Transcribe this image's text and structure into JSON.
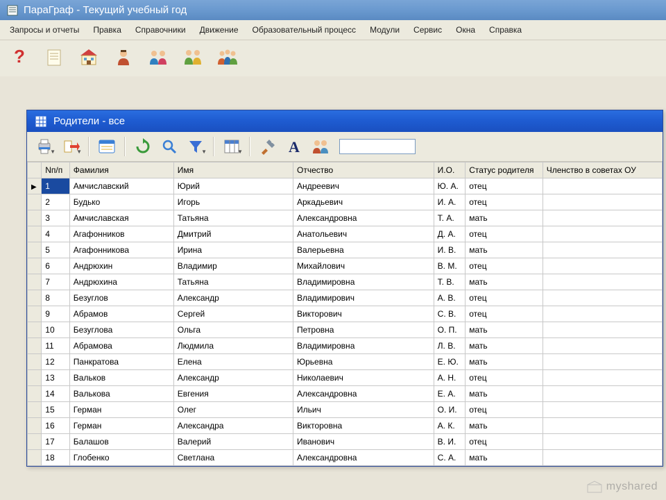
{
  "app": {
    "title": "ПараГраф - Текущий учебный год"
  },
  "menu": {
    "items": [
      "Запросы и отчеты",
      "Правка",
      "Справочники",
      "Движение",
      "Образовательный процесс",
      "Модули",
      "Сервис",
      "Окна",
      "Справка"
    ]
  },
  "child": {
    "title": "Родители - все",
    "search_value": ""
  },
  "table": {
    "headers": {
      "num": "Nп/п",
      "fam": "Фамилия",
      "name": "Имя",
      "pat": "Отчество",
      "init": "И.О.",
      "status": "Статус родителя",
      "member": "Членство в советах ОУ"
    },
    "rows": [
      {
        "n": "1",
        "fam": "Амчиславский",
        "name": "Юрий",
        "pat": "Андреевич",
        "init": "Ю. А.",
        "status": "отец",
        "member": ""
      },
      {
        "n": "2",
        "fam": "Будько",
        "name": "Игорь",
        "pat": "Аркадьевич",
        "init": "И. А.",
        "status": "отец",
        "member": ""
      },
      {
        "n": "3",
        "fam": "Амчиславская",
        "name": "Татьяна",
        "pat": "Александровна",
        "init": "Т. А.",
        "status": "мать",
        "member": ""
      },
      {
        "n": "4",
        "fam": "Агафонников",
        "name": "Дмитрий",
        "pat": "Анатольевич",
        "init": "Д. А.",
        "status": "отец",
        "member": ""
      },
      {
        "n": "5",
        "fam": "Агафонникова",
        "name": "Ирина",
        "pat": "Валерьевна",
        "init": "И. В.",
        "status": "мать",
        "member": ""
      },
      {
        "n": "6",
        "fam": "Андрюхин",
        "name": "Владимир",
        "pat": "Михайлович",
        "init": "В. М.",
        "status": "отец",
        "member": ""
      },
      {
        "n": "7",
        "fam": "Андрюхина",
        "name": "Татьяна",
        "pat": "Владимировна",
        "init": "Т. В.",
        "status": "мать",
        "member": ""
      },
      {
        "n": "8",
        "fam": "Безуглов",
        "name": "Александр",
        "pat": "Владимирович",
        "init": "А. В.",
        "status": "отец",
        "member": ""
      },
      {
        "n": "9",
        "fam": "Абрамов",
        "name": "Сергей",
        "pat": "Викторович",
        "init": "С. В.",
        "status": "отец",
        "member": ""
      },
      {
        "n": "10",
        "fam": "Безуглова",
        "name": "Ольга",
        "pat": "Петровна",
        "init": "О. П.",
        "status": "мать",
        "member": ""
      },
      {
        "n": "11",
        "fam": "Абрамова",
        "name": "Людмила",
        "pat": "Владимировна",
        "init": "Л. В.",
        "status": "мать",
        "member": ""
      },
      {
        "n": "12",
        "fam": "Панкратова",
        "name": "Елена",
        "pat": "Юрьевна",
        "init": "Е. Ю.",
        "status": "мать",
        "member": ""
      },
      {
        "n": "13",
        "fam": "Вальков",
        "name": "Александр",
        "pat": "Николаевич",
        "init": "А. Н.",
        "status": "отец",
        "member": ""
      },
      {
        "n": "14",
        "fam": "Валькова",
        "name": "Евгения",
        "pat": "Александровна",
        "init": "Е. А.",
        "status": "мать",
        "member": ""
      },
      {
        "n": "15",
        "fam": "Герман",
        "name": "Олег",
        "pat": "Ильич",
        "init": "О. И.",
        "status": "отец",
        "member": ""
      },
      {
        "n": "16",
        "fam": "Герман",
        "name": "Александра",
        "pat": "Викторовна",
        "init": "А. К.",
        "status": "мать",
        "member": ""
      },
      {
        "n": "17",
        "fam": "Балашов",
        "name": "Валерий",
        "pat": "Иванович",
        "init": "В. И.",
        "status": "отец",
        "member": ""
      },
      {
        "n": "18",
        "fam": "Глобенко",
        "name": "Светлана",
        "pat": "Александровна",
        "init": "С. А.",
        "status": "мать",
        "member": ""
      }
    ],
    "selected_index": 0
  },
  "watermark": {
    "text": "myshared"
  }
}
